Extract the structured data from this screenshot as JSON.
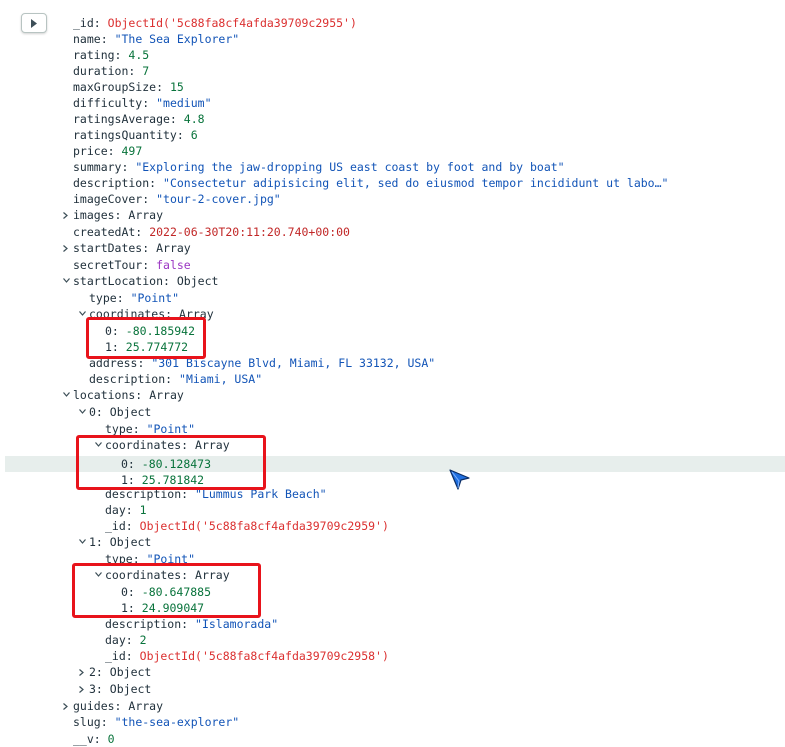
{
  "expand_button_icon": "caret-right-icon",
  "document": {
    "_id": "ObjectId('5c88fa8cf4afda39709c2955')",
    "name": "\"The Sea Explorer\"",
    "rating": "4.5",
    "duration": "7",
    "maxGroupSize": "15",
    "difficulty": "\"medium\"",
    "ratingsAverage": "4.8",
    "ratingsQuantity": "6",
    "price": "497",
    "summary": "\"Exploring the jaw-dropping US east coast by foot and by boat\"",
    "description": "\"Consectetur adipisicing elit, sed do eiusmod tempor incididunt ut labo…\"",
    "imageCover": "\"tour-2-cover.jpg\"",
    "images": "Array",
    "createdAt": "2022-06-30T20:11:20.740+00:00",
    "startDates": "Array",
    "secretTour": "false",
    "startLocation": {
      "type_label": "Object",
      "type": "\"Point\"",
      "coordinates_label": "Array",
      "coord_0": "-80.185942",
      "coord_1": "25.774772",
      "address": "\"301 Biscayne Blvd, Miami, FL 33132, USA\"",
      "description": "\"Miami, USA\""
    },
    "locations": {
      "type_label": "Array",
      "items": [
        {
          "index": "0",
          "type_label": "Object",
          "type": "\"Point\"",
          "coordinates_label": "Array",
          "coord_0": "-80.128473",
          "coord_1": "25.781842",
          "description": "\"Lummus Park Beach\"",
          "day": "1",
          "_id": "ObjectId('5c88fa8cf4afda39709c2959')"
        },
        {
          "index": "1",
          "type_label": "Object",
          "type": "\"Point\"",
          "coordinates_label": "Array",
          "coord_0": "-80.647885",
          "coord_1": "24.909047",
          "description": "\"Islamorada\"",
          "day": "2",
          "_id": "ObjectId('5c88fa8cf4afda39709c2958')"
        },
        {
          "index": "2",
          "type_label": "Object"
        },
        {
          "index": "3",
          "type_label": "Object"
        }
      ]
    },
    "guides": "Array",
    "slug": "\"the-sea-explorer\"",
    "__v": "0"
  },
  "keys": {
    "_id": "_id:",
    "name": "name:",
    "rating": "rating:",
    "duration": "duration:",
    "maxGroupSize": "maxGroupSize:",
    "difficulty": "difficulty:",
    "ratingsAverage": "ratingsAverage:",
    "ratingsQuantity": "ratingsQuantity:",
    "price": "price:",
    "summary": "summary:",
    "description": "description:",
    "imageCover": "imageCover:",
    "images": "images:",
    "createdAt": "createdAt:",
    "startDates": "startDates:",
    "secretTour": "secretTour:",
    "startLocation": "startLocation:",
    "type": "type:",
    "coordinates": "coordinates:",
    "zero": "0:",
    "one": "1:",
    "two": "2:",
    "three": "3:",
    "address": "address:",
    "locations": "locations:",
    "day": "day:",
    "guides": "guides:",
    "slug": "slug:",
    "__v": "__v:"
  },
  "highlight_color": "#e8131b"
}
